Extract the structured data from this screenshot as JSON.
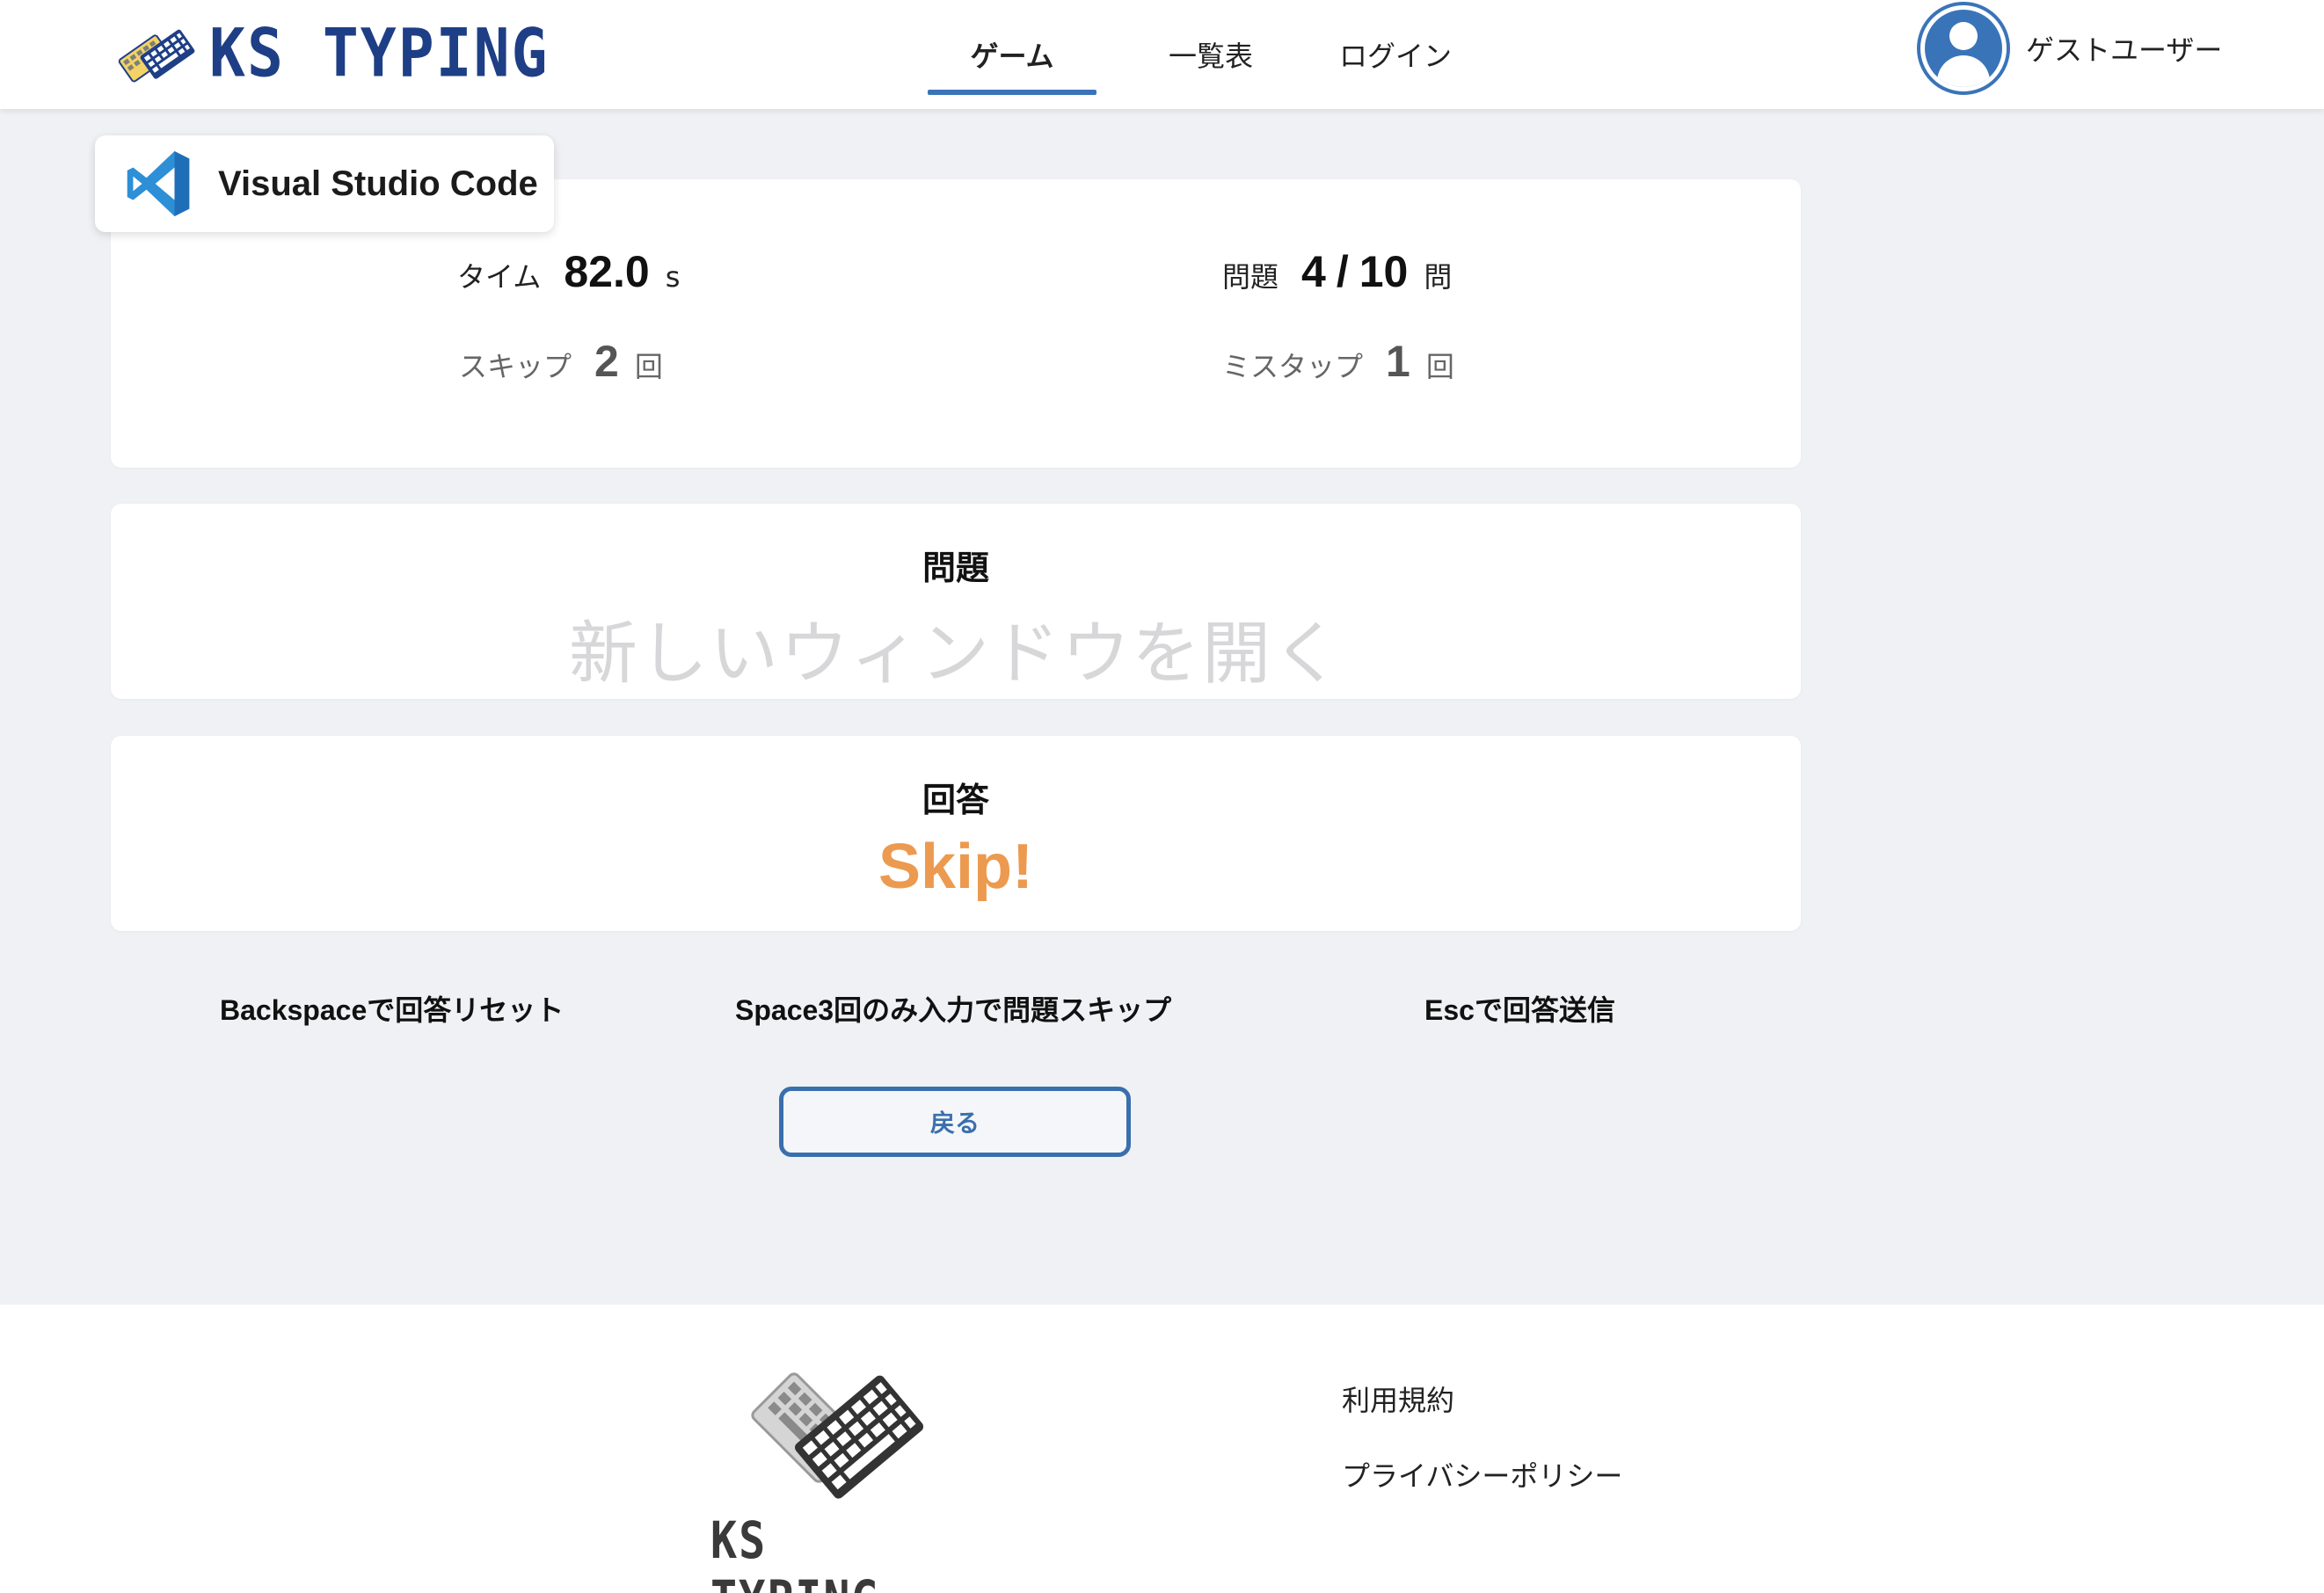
{
  "header": {
    "logo_text": "KS TYPING",
    "nav": [
      {
        "label": "ゲーム",
        "active": true
      },
      {
        "label": "一覧表",
        "active": false
      },
      {
        "label": "ログイン",
        "active": false
      }
    ],
    "user_name": "ゲストユーザー"
  },
  "app": {
    "name": "Visual Studio Code",
    "icon": "vscode-icon"
  },
  "stats": {
    "time_label": "タイム",
    "time_value": "82.0",
    "time_unit": "s",
    "question_label": "問題",
    "question_current": "4",
    "question_sep": "/",
    "question_total": "10",
    "question_unit": "問",
    "skip_label": "スキップ",
    "skip_value": "2",
    "skip_unit": "回",
    "miss_label": "ミスタップ",
    "miss_value": "1",
    "miss_unit": "回"
  },
  "question": {
    "title": "問題",
    "text": "新しいウィンドウを開く"
  },
  "answer": {
    "title": "回答",
    "text": "Skip!"
  },
  "hints": [
    "Backspaceで回答リセット",
    "Space3回のみ入力で問題スキップ",
    "Escで回答送信"
  ],
  "back_button": "戻る",
  "footer": {
    "logo_text": "KS TYPING",
    "links": [
      "利用規約",
      "プライバシーポリシー"
    ]
  },
  "colors": {
    "accent": "#3a74b8",
    "brand": "#1e3f86",
    "answer": "#ec9a4f",
    "background": "#f0f1f4"
  }
}
